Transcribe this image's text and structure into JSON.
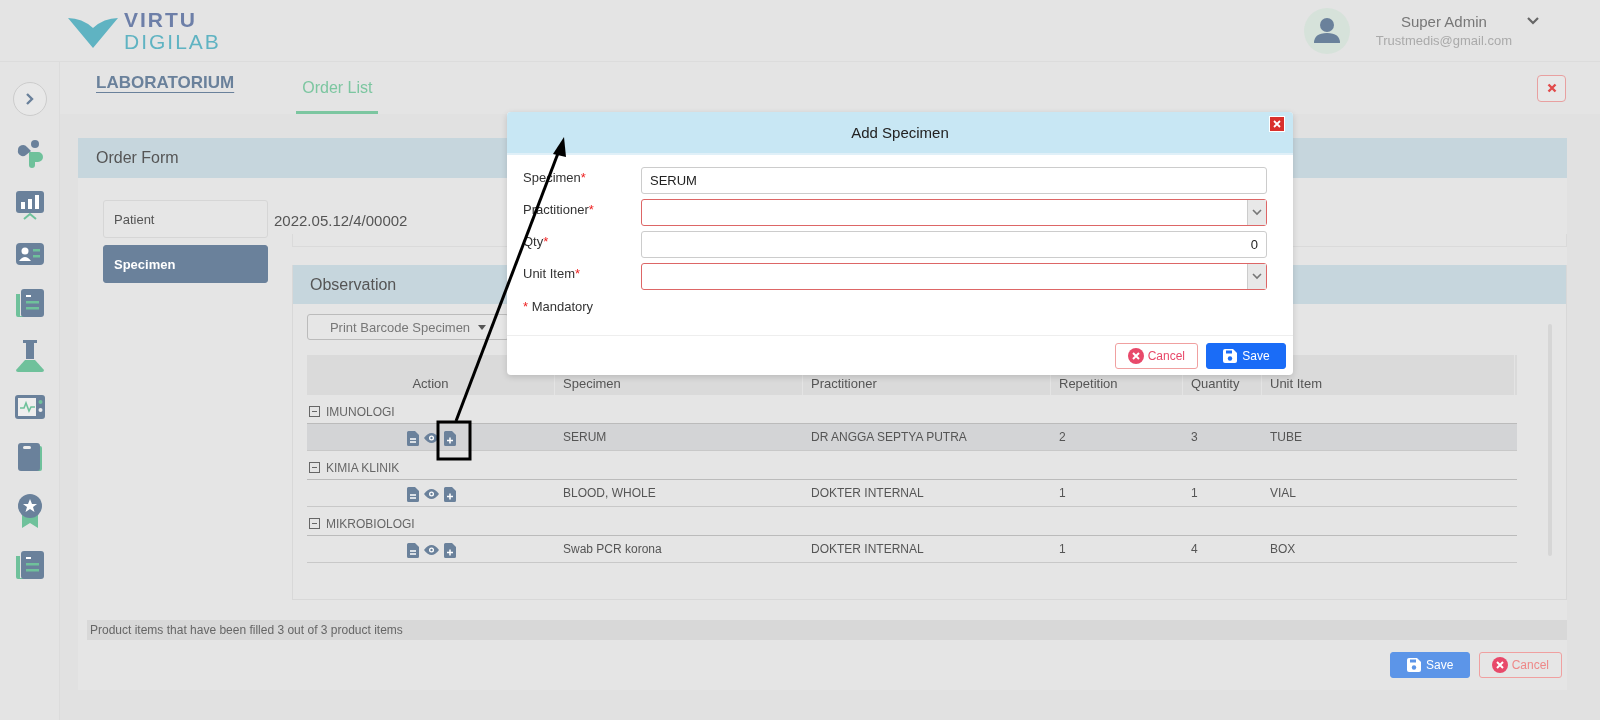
{
  "brand": {
    "line1": "VIRTU",
    "line2": "DIGILAB"
  },
  "user": {
    "name": "Super Admin",
    "email": "Trustmedis@gmail.com"
  },
  "module_title": "LABORATORIUM",
  "tabs": [
    {
      "label": "Order List",
      "selected": true
    }
  ],
  "order_form": {
    "title": "Order Form",
    "nav": [
      {
        "label": "Patient",
        "selected": false
      },
      {
        "label": "Specimen",
        "selected": true
      }
    ],
    "order_number": "2022.05.12/4/00002"
  },
  "observation": {
    "title": "Observation",
    "print_button": "Print Barcode Specimen",
    "columns": [
      "Action",
      "Specimen",
      "Practitioner",
      "Repetition",
      "Quantity",
      "Unit Item"
    ],
    "groups": [
      {
        "name": "IMUNOLOGI",
        "expanded": true,
        "rows": [
          {
            "specimen": "SERUM",
            "practitioner": "DR ANGGA SEPTYA PUTRA",
            "repetition": "2",
            "quantity": "3",
            "unit_item": "TUBE",
            "selected": true
          }
        ]
      },
      {
        "name": "KIMIA KLINIK",
        "expanded": true,
        "rows": [
          {
            "specimen": "BLOOD, WHOLE",
            "practitioner": "DOKTER INTERNAL",
            "repetition": "1",
            "quantity": "1",
            "unit_item": "VIAL",
            "selected": false
          }
        ]
      },
      {
        "name": "MIKROBIOLOGI",
        "expanded": true,
        "rows": [
          {
            "specimen": "Swab PCR korona",
            "practitioner": "DOKTER INTERNAL",
            "repetition": "1",
            "quantity": "4",
            "unit_item": "BOX",
            "selected": false
          }
        ]
      }
    ]
  },
  "status": "Product items that have been filled 3 out of 3 product items",
  "form_buttons": [
    {
      "label": "Save",
      "kind": "save"
    },
    {
      "label": "Cancel",
      "kind": "cancel"
    }
  ],
  "dialog": {
    "title": "Add Specimen",
    "required_mark": "*",
    "fields": [
      {
        "label": "Specimen",
        "kind": "text",
        "value": "SERUM",
        "required": true,
        "invalid": false
      },
      {
        "label": "Practitioner",
        "kind": "select",
        "required": true,
        "invalid": true
      },
      {
        "label": "Qty",
        "kind": "number",
        "value": "0",
        "required": true,
        "invalid": false
      },
      {
        "label": "Unit Item",
        "kind": "select",
        "required": true,
        "invalid": true
      }
    ],
    "mandatory_note": "Mandatory",
    "buttons": [
      {
        "label": "Cancel",
        "kind": "cancel"
      },
      {
        "label": "Save",
        "kind": "save"
      }
    ]
  }
}
